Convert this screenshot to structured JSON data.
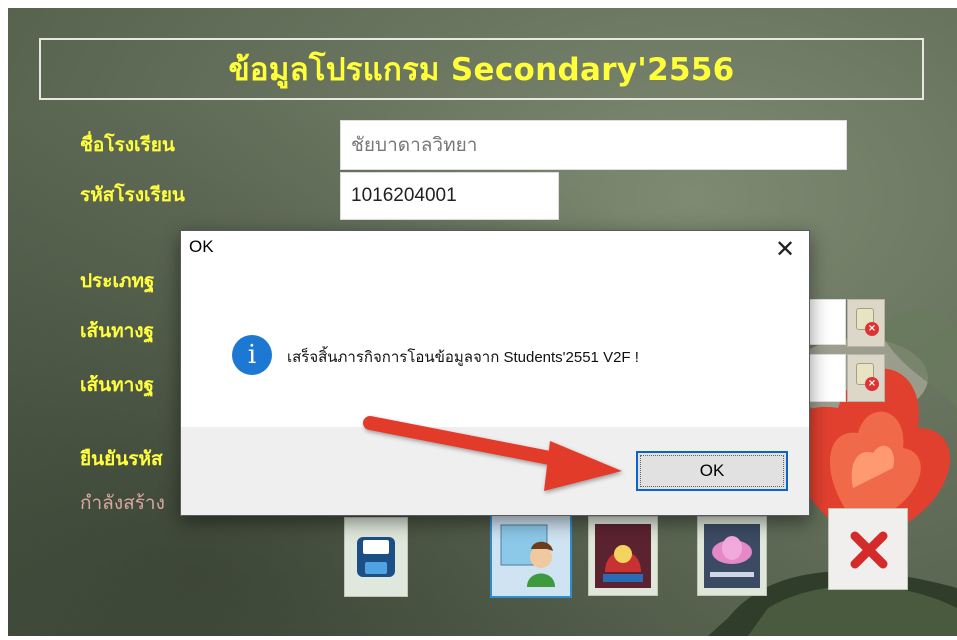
{
  "app": {
    "title": "ข้อมูลโปรแกรม Secondary'2556",
    "fields": {
      "school_name_label": "ชื่อโรงเรียน",
      "school_name_value": "ชัยบาดาลวิทยา",
      "school_code_label": "รหัสโรงเรียน",
      "school_code_value": "1016204001",
      "db_type_label": "ประเภทฐ",
      "db_path1_label": "เส้นทางฐ",
      "db_path2_label": "เส้นทางฐ",
      "confirm_label": "ยืนยันรหัส",
      "faded_label": "กำลังสร้าง"
    },
    "icons": {
      "save": "floppy-disk-icon",
      "student": "student-icon",
      "students2551": "students-2551-icon",
      "studentbook": "studentbook-icon",
      "close": "red-x-icon"
    }
  },
  "dialog": {
    "title": "OK",
    "close_glyph": "✕",
    "icon": "information-icon",
    "icon_glyph": "i",
    "message": "เสร็จสิ้นภารกิจการโอนข้อมูลจาก Students'2551 V2F !",
    "ok_label": "OK"
  },
  "colors": {
    "title_text": "#ffff3a",
    "label_text": "#ffff40",
    "info_icon": "#1d78d4",
    "ok_focus_border": "#0a63c9",
    "annotation_arrow": "#e23b2b"
  }
}
